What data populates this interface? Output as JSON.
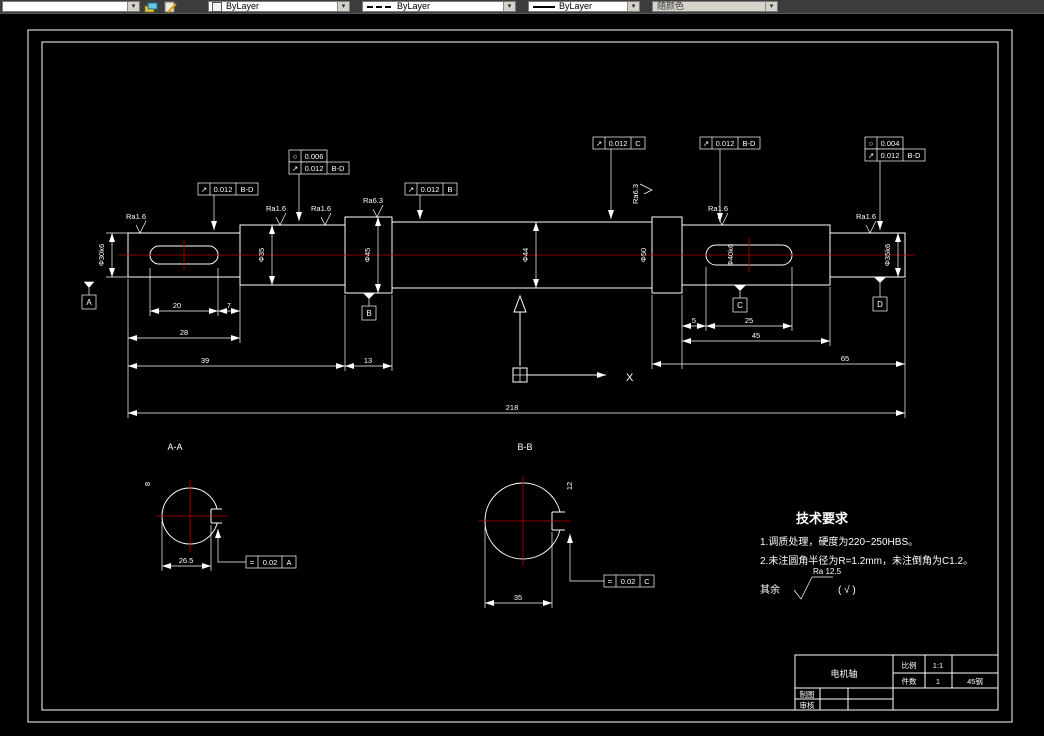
{
  "toolbar": {
    "layer_combo_value": "",
    "color_combo": "ByLayer",
    "linetype_combo": "ByLayer",
    "lineweight_combo": "ByLayer",
    "plotstyle_combo": "随颜色"
  },
  "gdt": {
    "g1a": {
      "sym": "○",
      "val": "0.006"
    },
    "g1b": {
      "sym": "↗",
      "val": "0.012",
      "ref": "B-D"
    },
    "g2": {
      "sym": "↗",
      "val": "0.012",
      "ref": "B-D"
    },
    "g3": {
      "sym": "↗",
      "val": "0.012",
      "ref": "B"
    },
    "g4": {
      "sym": "↗",
      "val": "0.012",
      "ref": "C"
    },
    "g5": {
      "sym": "↗",
      "val": "0.012",
      "ref": "B-D"
    },
    "g6a": {
      "sym": "○",
      "val": "0.004"
    },
    "g6b": {
      "sym": "↗",
      "val": "0.012",
      "ref": "B-D"
    },
    "g7": {
      "sym": "=",
      "val": "0.02",
      "ref": "A"
    },
    "g8": {
      "sym": "=",
      "val": "0.02",
      "ref": "C"
    }
  },
  "datums": {
    "a": "A",
    "b": "B",
    "c": "C",
    "d": "D"
  },
  "roughness": {
    "r1": "Ra1.6",
    "r2": "Ra1.6",
    "r3": "Ra1.6",
    "r4": "Ra6.3",
    "r5": "Ra6.3",
    "r6": "Ra1.6",
    "r7": "Ra1.6"
  },
  "dims": {
    "keyway_left": "20",
    "key_off_left": "7",
    "d28": "28",
    "d39": "39",
    "d13": "13",
    "total": "218",
    "d5": "5",
    "keyway_right": "25",
    "d45": "45",
    "d65": "65"
  },
  "dias": {
    "v1": "Φ30k6",
    "v2": "Φ35",
    "v3": "Φ45",
    "v4": "Φ44",
    "v5": "Φ50",
    "v6": "Φ40k6",
    "v7": "Φ35k6"
  },
  "sections": {
    "left": {
      "label": "A-A",
      "width_dim": "26.5",
      "side_dim": "8"
    },
    "right": {
      "label": "B-B",
      "width_dim": "35",
      "side_dim": "12"
    }
  },
  "ucs": {
    "x_label": "X"
  },
  "tech": {
    "title": "技术要求",
    "line1": "1.调质处理，硬度为220~250HBS。",
    "line2": "2.未注圆角半径为R=1.2mm，未注倒角为C1.2。",
    "rest_prefix": "其余",
    "rest_ra": "Ra 12.5",
    "rest_paren": "( √ )"
  },
  "title_block": {
    "part_name": "电机轴",
    "scale_label": "比例",
    "scale_value": "1:1",
    "qty_label": "件数",
    "qty_value": "1",
    "material": "45钢",
    "drawn_label": "制图",
    "checked_label": "审核"
  }
}
